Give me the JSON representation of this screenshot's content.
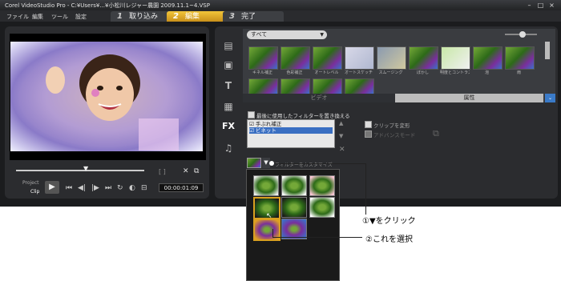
{
  "window": {
    "title": "Corel VideoStudio Pro - C:¥Users¥...¥小松川レジャー農園 2009.11.1~4.VSP"
  },
  "menu": [
    "ファイル",
    "編集",
    "ツール",
    "設定"
  ],
  "steps": [
    {
      "num": "1",
      "label": "取り込み"
    },
    {
      "num": "2",
      "label": "編集"
    },
    {
      "num": "3",
      "label": "完了"
    }
  ],
  "preview": {
    "project_label": "Project",
    "clip_label": "Clip",
    "timecode": "00:00:01:09"
  },
  "library": {
    "category": "すべて",
    "thumbs_row1": [
      "キネル補正",
      "色彩補正",
      "オートレベル",
      "オートスケッチ",
      "スムージング",
      "ぼかし",
      "明度とコントラスト",
      "泡",
      "雨",
      "雲"
    ],
    "tab_video": "ビデオ",
    "tab_attribute": "属性"
  },
  "options": {
    "replace_filter_label": "最後に使用したフィルターを置き換える",
    "filters": [
      "手ぶれ補正",
      "ビネット"
    ],
    "transform_clip_label": "クリップを変形",
    "advanced_label": "アドバンスモード",
    "customize_label": "フィルターをカスタマイズ"
  },
  "annotations": {
    "step1": "①▼をクリック",
    "step2": "②これを選択"
  },
  "colors": {
    "accent": "#d9a020",
    "selection": "#3a6fc2"
  }
}
